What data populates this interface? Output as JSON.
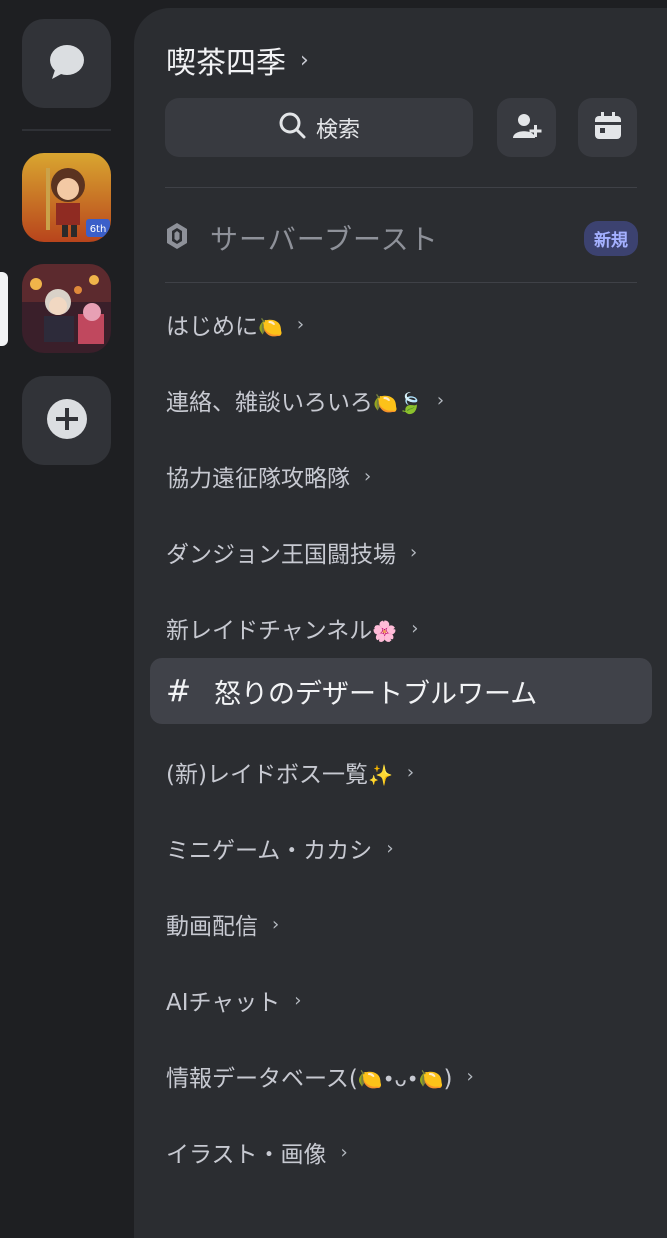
{
  "server": {
    "title": "喫茶四季",
    "title_chevron": "›"
  },
  "search": {
    "label": "検索",
    "icon": "search-icon"
  },
  "actions": {
    "invite_icon": "add-user-icon",
    "events_icon": "calendar-icon"
  },
  "boost": {
    "label": "サーバーブースト",
    "badge": "新規",
    "icon": "boost-gem-icon"
  },
  "rail": {
    "dm_icon": "chat-bubble-icon",
    "add_icon": "plus-icon"
  },
  "categories": [
    {
      "label": "はじめに",
      "emoji": "🍋"
    },
    {
      "label": "連絡、雑談いろいろ",
      "emoji": "🍋🍃"
    },
    {
      "label": "協力遠征隊攻略隊",
      "emoji": ""
    },
    {
      "label": "ダンジョン王国闘技場",
      "emoji": ""
    },
    {
      "label": "新レイドチャンネル",
      "emoji": "🌸"
    }
  ],
  "active_channel": {
    "hash": "#",
    "name": "怒りのデザートブルワーム"
  },
  "categories_after": [
    {
      "label": "(新)レイドボス一覧",
      "emoji": "✨"
    },
    {
      "label": "ミニゲーム・カカシ",
      "emoji": ""
    },
    {
      "label": "動画配信",
      "emoji": ""
    },
    {
      "label": "AIチャット",
      "emoji": ""
    },
    {
      "label": "情報データベース(",
      "emoji": "🍋•ᴗ•🍋",
      "suffix": ")"
    },
    {
      "label": "イラスト・画像",
      "emoji": ""
    }
  ],
  "chevron": "›"
}
